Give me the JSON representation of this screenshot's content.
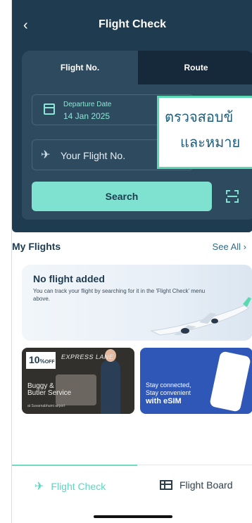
{
  "header": {
    "back_icon": "chevron-left-icon",
    "title": "Flight Check"
  },
  "search_card": {
    "tabs": [
      {
        "label": "Flight No.",
        "active": true
      },
      {
        "label": "Route",
        "active": false
      }
    ],
    "departure": {
      "label": "Departure Date",
      "value": "14 Jan 2025",
      "icon": "calendar-icon"
    },
    "flight_input": {
      "placeholder": "Your Flight No.",
      "icon": "airplane-icon"
    },
    "search_label": "Search",
    "scan_icon": "barcode-scan-icon",
    "accent_color": "#7fe1cf"
  },
  "overlay": {
    "line1": "ตรวจสอบข้",
    "line2": "และหมาย"
  },
  "my_flights": {
    "title": "My Flights",
    "see_all": "See All",
    "empty_title": "No flight added",
    "empty_text": "You can track your flight by searching for it in the 'Flight Check' menu above."
  },
  "banners": [
    {
      "badge_num": "10",
      "badge_pct": "%",
      "badge_off": "OFF",
      "lane": "EXPRESS LANE",
      "title_line1": "Buggy &",
      "title_line2": "Butler Service",
      "subtitle": "at Suvarnabhumi airport"
    },
    {
      "line1": "Stay connected,",
      "line2": "Stay convenient",
      "line3": "with eSIM"
    }
  ],
  "bottom_nav": [
    {
      "label": "Flight Check",
      "icon": "airplane-icon",
      "active": true
    },
    {
      "label": "Flight Board",
      "icon": "board-icon",
      "active": false
    }
  ]
}
